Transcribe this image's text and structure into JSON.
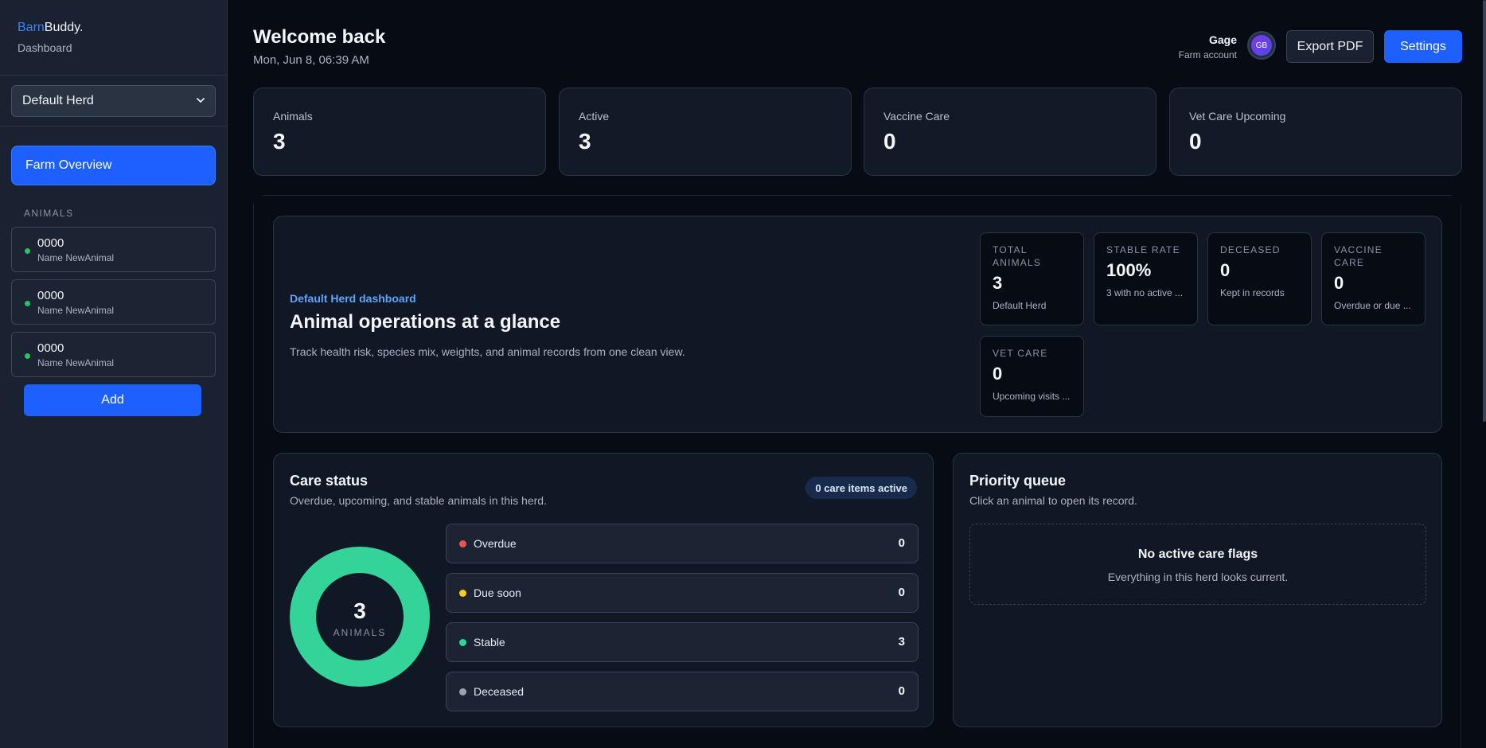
{
  "app": {
    "brand_part1": "Barn",
    "brand_part2": "Buddy.",
    "brand_subtitle": "Dashboard"
  },
  "sidebar": {
    "herd_select": "Default Herd",
    "farm_overview": "Farm Overview",
    "section_label": "ANIMALS",
    "animals": [
      {
        "id": "0000",
        "name": "Name NewAnimal",
        "status_color": "#22c55e"
      },
      {
        "id": "0000",
        "name": "Name NewAnimal",
        "status_color": "#22c55e"
      },
      {
        "id": "0000",
        "name": "Name NewAnimal",
        "status_color": "#22c55e"
      }
    ],
    "add_label": "Add"
  },
  "header": {
    "title": "Welcome back",
    "date": "Mon, Jun 8, 06:39 AM",
    "user_name": "Gage",
    "user_role": "Farm account",
    "avatar_initials": "GB",
    "export_label": "Export PDF",
    "settings_label": "Settings"
  },
  "stats": [
    {
      "label": "Animals",
      "value": "3"
    },
    {
      "label": "Active",
      "value": "3"
    },
    {
      "label": "Vaccine Care",
      "value": "0"
    },
    {
      "label": "Vet Care Upcoming",
      "value": "0"
    }
  ],
  "hero": {
    "tag": "Default Herd dashboard",
    "title": "Animal operations at a glance",
    "description": "Track health risk, species mix, weights, and animal records from one clean view.",
    "metrics": [
      {
        "label": "TOTAL ANIMALS",
        "value": "3",
        "sub": "Default Herd"
      },
      {
        "label": "STABLE RATE",
        "value": "100%",
        "sub": "3 with no active ..."
      },
      {
        "label": "DECEASED",
        "value": "0",
        "sub": "Kept in records"
      },
      {
        "label": "VACCINE CARE",
        "value": "0",
        "sub": "Overdue or due ..."
      },
      {
        "label": "VET CARE",
        "value": "0",
        "sub": "Upcoming visits ..."
      }
    ]
  },
  "care_status": {
    "title": "Care status",
    "subtitle": "Overdue, upcoming, and stable animals in this herd.",
    "badge": "0 care items active",
    "donut_total": "3",
    "donut_label": "ANIMALS",
    "rows": [
      {
        "label": "Overdue",
        "count": "0",
        "color": "#f05252"
      },
      {
        "label": "Due soon",
        "count": "0",
        "color": "#facc15"
      },
      {
        "label": "Stable",
        "count": "3",
        "color": "#34d399"
      },
      {
        "label": "Deceased",
        "count": "0",
        "color": "#9ca3af"
      }
    ]
  },
  "priority_queue": {
    "title": "Priority queue",
    "subtitle": "Click an animal to open its record.",
    "empty_title": "No active care flags",
    "empty_sub": "Everything in this herd looks current."
  },
  "colors": {
    "accent": "#1d5fff",
    "stable": "#34d399"
  }
}
